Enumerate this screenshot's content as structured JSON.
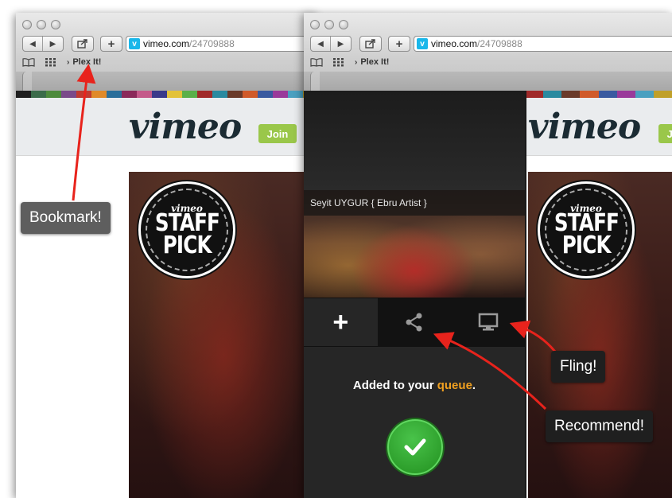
{
  "browser": {
    "url_domain": "vimeo.com",
    "url_path": "/24709888",
    "bookmark_label": "Plex It!",
    "bookmark_chevron": "›",
    "favicon_letter": "v"
  },
  "vimeo": {
    "logo": "vimeo",
    "join_label": "Join",
    "staff_pick": {
      "brand": "vimeo",
      "line1": "STAFF",
      "line2": "PICK"
    },
    "stripe_colors": [
      "#1f1f1f",
      "#3b6b4a",
      "#4d8a3c",
      "#7a4a8a",
      "#c23a2f",
      "#e08a2a",
      "#2a6e9a",
      "#8a2a5a",
      "#c45a8a",
      "#3a3a8a",
      "#e3c23a",
      "#5ab04a",
      "#a02a2a",
      "#2a8aa0",
      "#6a3a2a",
      "#d05a2a",
      "#3a5aa0",
      "#9a3a9a",
      "#4aa0c0",
      "#c0a02a"
    ]
  },
  "plex": {
    "video_title": "Seyit UYGUR { Ebru Artist }",
    "message_prefix": "Added to your",
    "message_link": "queue",
    "message_suffix": ".",
    "actions": [
      {
        "icon": "plus-icon",
        "label": "+"
      },
      {
        "icon": "share-icon"
      },
      {
        "icon": "monitor-icon"
      }
    ]
  },
  "annotations": {
    "bookmark": "Bookmark!",
    "fling": "Fling!",
    "recommend": "Recommend!"
  },
  "colors": {
    "arrow": "#e8231c",
    "vimeo_blue": "#1ab7ea",
    "join_green": "#9ac74a",
    "queue_orange": "#f0a020",
    "check_green": "#2aa02a"
  }
}
